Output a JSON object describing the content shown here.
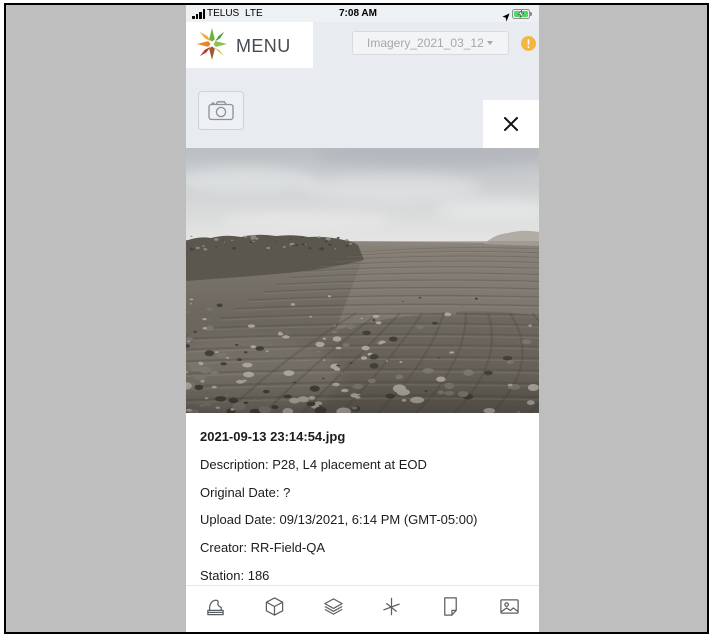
{
  "status_bar": {
    "carrier": "TELUS",
    "network": "LTE",
    "time": "7:08 AM",
    "signal_bars": 4,
    "battery_level": 1,
    "icons": [
      "signal-icon",
      "location-arrow-icon",
      "battery-charging-icon"
    ]
  },
  "header": {
    "logo_icon": "compass-star-logo",
    "menu_label": "MENU",
    "imagery_select": {
      "value": "Imagery_2021_03_12",
      "icon": "caret-down-icon"
    },
    "alert_icon": "alert-icon"
  },
  "actions": {
    "camera_icon": "camera-icon",
    "close_icon": "close-icon"
  },
  "photo": {
    "filename": "2021-09-13 23:14:54.jpg",
    "fields": [
      {
        "label": "Description:",
        "value": "P28, L4 placement at EOD"
      },
      {
        "label": "Original Date:",
        "value": "?"
      },
      {
        "label": "Upload Date:",
        "value": "09/13/2021, 6:14 PM (GMT-05:00)"
      },
      {
        "label": "Creator:",
        "value": "RR-Field-QA"
      },
      {
        "label": "Station:",
        "value": "186"
      }
    ]
  },
  "toolbar": {
    "items": [
      {
        "icon": "terrain-icon"
      },
      {
        "icon": "cube-icon"
      },
      {
        "icon": "layers-icon"
      },
      {
        "icon": "cross-section-icon"
      },
      {
        "icon": "document-icon"
      },
      {
        "icon": "image-icon"
      }
    ]
  },
  "colors": {
    "header_background": "#e8ecf0",
    "alert": "#f4b63f",
    "battery": "#4cd964",
    "icon_stroke": "#5a5f64"
  }
}
